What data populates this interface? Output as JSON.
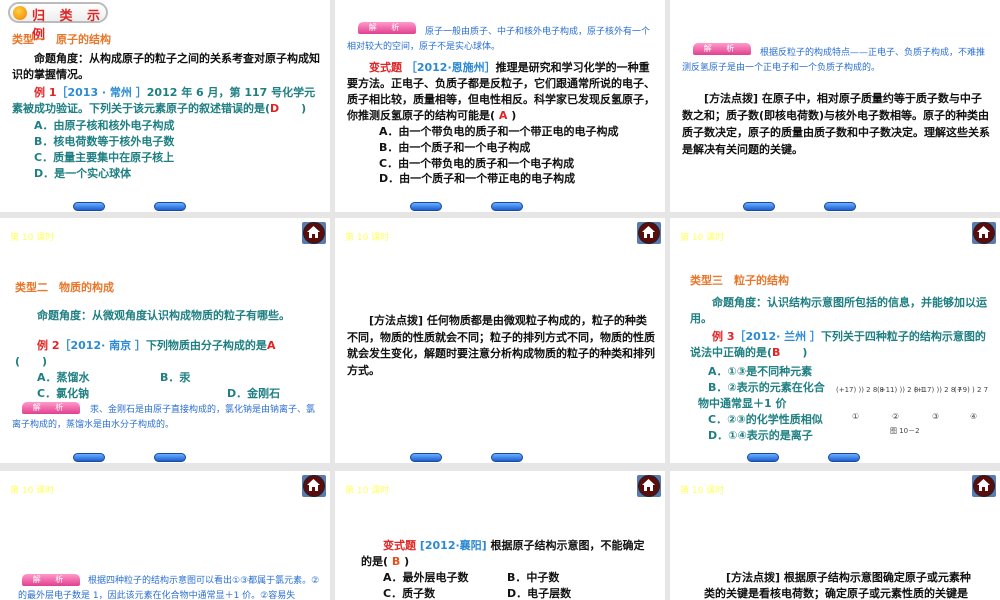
{
  "lesson_label": "第 10 课时",
  "analysis_badge": "解 析",
  "slides": [
    {
      "header": "归 类 示 例",
      "type_heading": "类型一　原子的结构",
      "angle": "命题角度：从构成原子的粒子之间的关系考查对原子构成知识的掌握情况。",
      "example_label": "例 1",
      "example_source": "［2013 · 常州 ］",
      "example_text": "2012 年 6 月，第 117 号化学元素被成功验证。下列关于该元素原子的叙述错误的是(",
      "answer": "D",
      "close": ")",
      "options": [
        "A．由原子核和核外电子构成",
        "B．核电荷数等于核外电子数",
        "C．质量主要集中在原子核上",
        "D．是一个实心球体"
      ]
    },
    {
      "analysis": "原子一般由质子、中子和核外电子构成，原子核外有一个相对较大的空间，原子不是实心球体。",
      "variant_label": "变式题",
      "variant_source": "［2012·恩施州］",
      "variant_text": "推理是研究和学习化学的一种重要方法。正电子、负质子都是反粒子，它们跟通常所说的电子、质子相比较，质量相等，但电性相反。科学家已发现反氢原子，你推测反氢原子的结构可能是(",
      "answer": "A",
      "close": ")",
      "options": [
        "A．由一个带负电的质子和一个带正电的电子构成",
        "B．由一个质子和一个电子构成",
        "C．由一个带负电的质子和一个电子构成",
        "D．由一个质子和一个带正电的电子构成"
      ]
    },
    {
      "analysis": "根据反粒子的构成特点——正电子、负质子构成，不难推测反氢原子是由一个正电子和一个负质子构成的。",
      "method_label": "[方法点拨]",
      "method_text": "在原子中，相对原子质量约等于质子数与中子数之和；质子数(即核电荷数)与核外电子数相等。原子的种类由质子数决定，原子的质量由质子数和中子数决定。理解这些关系是解决有关问题的关键。"
    },
    {
      "type_heading": "类型二　物质的构成",
      "angle": "命题角度：从微观角度认识构成物质的粒子有哪些。",
      "example_label": "例 2",
      "example_source": "［2012· 南京 ］",
      "example_text": "下列物质由分子构成的是",
      "answer": "A",
      "paren": "(　　)",
      "options": [
        "A．蒸馏水",
        "B．汞",
        "C．氯化钠",
        "D．金刚石"
      ],
      "analysis": "汞、金刚石是由原子直接构成的，氯化钠是由钠离子、氯离子构成的，蒸馏水是由水分子构成的。"
    },
    {
      "method_label": "[方法点拨]",
      "method_text": "任何物质都是由微观粒子构成的，粒子的种类不同，物质的性质就会不同；粒子的排列方式不同，物质的性质就会发生变化，解题时要注意分析构成物质的粒子的种类和排列方式。"
    },
    {
      "type_heading": "类型三　粒子的结构",
      "angle": "命题角度：认识结构示意图所包括的信息，并能够加以运用。",
      "example_label": "例 3",
      "example_source": "［2012· 兰州 ］",
      "example_text": "下列关于四种粒子的结构示意图的说法中正确的是(",
      "answer": "B",
      "close": ")",
      "options": [
        "A．①③是不同种元素",
        "B．②表示的元素在化合物中通常显＋1 价",
        "C．②③的化学性质相似",
        "D．①④表示的是离子"
      ],
      "figure": {
        "atoms": [
          {
            "nucleus": "+17",
            "shells": "2 8 8",
            "label": "①"
          },
          {
            "nucleus": "+11",
            "shells": "2 8 1",
            "label": "②"
          },
          {
            "nucleus": "+17",
            "shells": "2 8 7",
            "label": "③"
          },
          {
            "nucleus": "+9",
            "shells": "2 7",
            "label": "④"
          }
        ],
        "caption": "图 10－2"
      }
    },
    {
      "analysis": "根据四种粒子的结构示意图可以看出①③都属于氯元素。②的最外层电子数是 1，因此该元素在化合物中通常显＋1 价。②容易失"
    },
    {
      "variant_label": "变式题",
      "variant_source": "[2012·襄阳]",
      "variant_text": "根据原子结构示意图，不能确定的是(",
      "answer": "B",
      "close": ")",
      "options": [
        "A．最外层电子数",
        "B．中子数",
        "C．质子数",
        "D．电子层数"
      ]
    },
    {
      "method_label": "[方法点拨]",
      "method_text": "根据原子结构示意图确定原子或元素种类的关键是看核电荷数；确定原子或元素性质的关键是"
    }
  ]
}
